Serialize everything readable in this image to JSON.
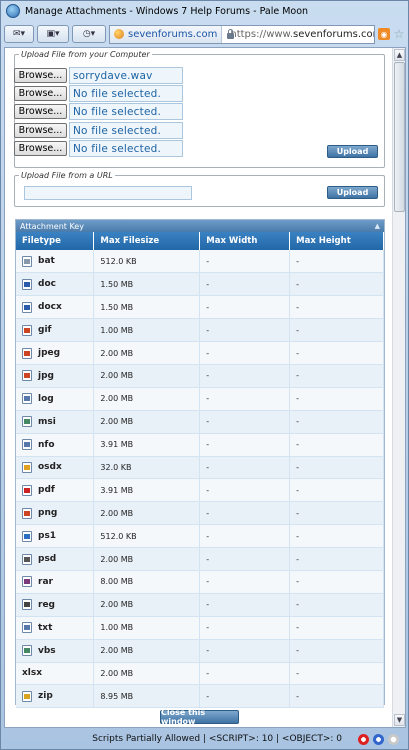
{
  "window": {
    "title": "Manage Attachments - Windows 7 Help Forums - Pale Moon"
  },
  "navbar": {
    "site_badge": "sevenforums.com",
    "url_prefix": "https://www.",
    "url_domain": "sevenforums.com",
    "url_suffix": ""
  },
  "upload_computer": {
    "legend": "Upload File from your Computer",
    "browse_label": "Browse...",
    "files": [
      "sorrydave.wav",
      "No file selected.",
      "No file selected.",
      "No file selected.",
      "No file selected."
    ],
    "upload_label": "Upload"
  },
  "upload_url": {
    "legend": "Upload File from a URL",
    "value": "",
    "upload_label": "Upload"
  },
  "attachment_key": {
    "title": "Attachment Key",
    "columns": [
      "Filetype",
      "Max Filesize",
      "Max Width",
      "Max Height"
    ],
    "rows": [
      {
        "type": "bat",
        "size": "512.0 KB",
        "width": "-",
        "height": "-",
        "icon": "bat-file-icon",
        "color": "#8899aa"
      },
      {
        "type": "doc",
        "size": "1.50 MB",
        "width": "-",
        "height": "-",
        "icon": "doc-file-icon",
        "color": "#2a5caa"
      },
      {
        "type": "docx",
        "size": "1.50 MB",
        "width": "-",
        "height": "-",
        "icon": "docx-file-icon",
        "color": "#2a5caa"
      },
      {
        "type": "gif",
        "size": "1.00 MB",
        "width": "-",
        "height": "-",
        "icon": "gif-file-icon",
        "color": "#cc4422"
      },
      {
        "type": "jpeg",
        "size": "2.00 MB",
        "width": "-",
        "height": "-",
        "icon": "jpeg-file-icon",
        "color": "#cc4422"
      },
      {
        "type": "jpg",
        "size": "2.00 MB",
        "width": "-",
        "height": "-",
        "icon": "jpg-file-icon",
        "color": "#cc4422"
      },
      {
        "type": "log",
        "size": "2.00 MB",
        "width": "-",
        "height": "-",
        "icon": "log-file-icon",
        "color": "#5577aa"
      },
      {
        "type": "msi",
        "size": "2.00 MB",
        "width": "-",
        "height": "-",
        "icon": "msi-file-icon",
        "color": "#448866"
      },
      {
        "type": "nfo",
        "size": "3.91 MB",
        "width": "-",
        "height": "-",
        "icon": "nfo-file-icon",
        "color": "#5577aa"
      },
      {
        "type": "osdx",
        "size": "32.0 KB",
        "width": "-",
        "height": "-",
        "icon": "osdx-file-icon",
        "color": "#e0a020"
      },
      {
        "type": "pdf",
        "size": "3.91 MB",
        "width": "-",
        "height": "-",
        "icon": "pdf-file-icon",
        "color": "#cc2222"
      },
      {
        "type": "png",
        "size": "2.00 MB",
        "width": "-",
        "height": "-",
        "icon": "png-file-icon",
        "color": "#cc4422"
      },
      {
        "type": "ps1",
        "size": "512.0 KB",
        "width": "-",
        "height": "-",
        "icon": "ps1-file-icon",
        "color": "#2a6fc0"
      },
      {
        "type": "psd",
        "size": "2.00 MB",
        "width": "-",
        "height": "-",
        "icon": "psd-file-icon",
        "color": "#555555"
      },
      {
        "type": "rar",
        "size": "8.00 MB",
        "width": "-",
        "height": "-",
        "icon": "rar-file-icon",
        "color": "#7a3a7a"
      },
      {
        "type": "reg",
        "size": "2.00 MB",
        "width": "-",
        "height": "-",
        "icon": "reg-file-icon",
        "color": "#444444"
      },
      {
        "type": "txt",
        "size": "1.00 MB",
        "width": "-",
        "height": "-",
        "icon": "txt-file-icon",
        "color": "#5577aa"
      },
      {
        "type": "vbs",
        "size": "2.00 MB",
        "width": "-",
        "height": "-",
        "icon": "vbs-file-icon",
        "color": "#448866"
      },
      {
        "type": "xlsx",
        "size": "2.00 MB",
        "width": "-",
        "height": "-",
        "icon": "",
        "color": ""
      },
      {
        "type": "zip",
        "size": "8.95 MB",
        "width": "-",
        "height": "-",
        "icon": "zip-file-icon",
        "color": "#d9a520"
      }
    ]
  },
  "close_label": "Close this window",
  "statusbar": {
    "text": "Scripts Partially Allowed | <SCRIPT>: 10 | <OBJECT>: 0"
  }
}
